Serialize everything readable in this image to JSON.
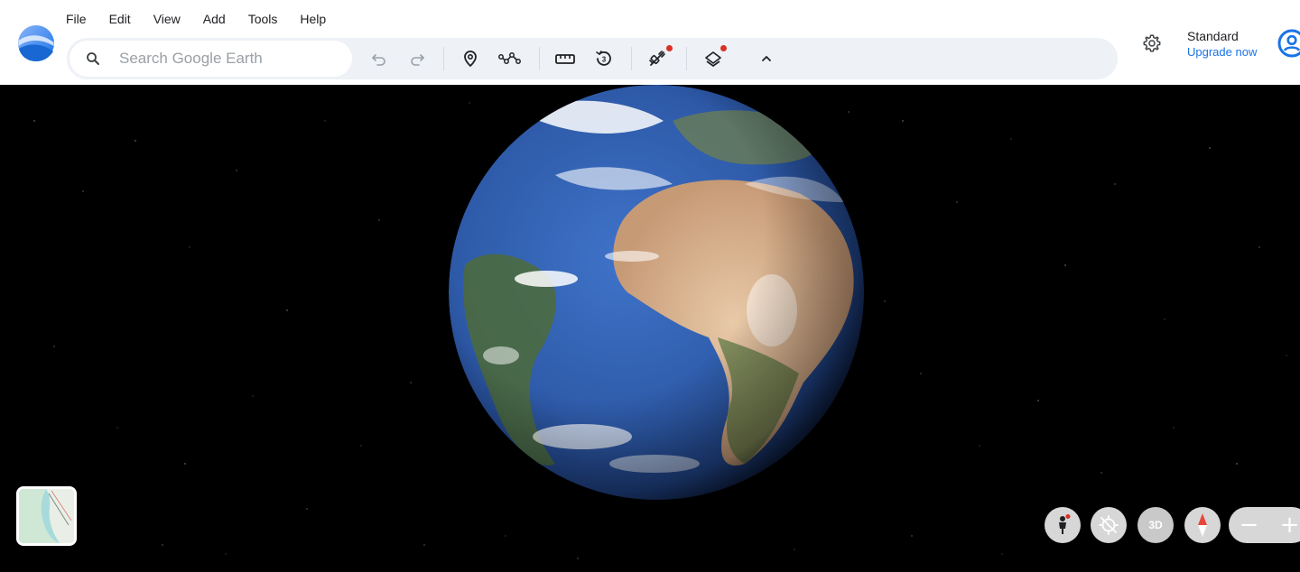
{
  "app": {
    "logo": "google-earth-logo"
  },
  "menu": {
    "items": [
      "File",
      "Edit",
      "View",
      "Add",
      "Tools",
      "Help"
    ]
  },
  "search": {
    "placeholder": "Search Google Earth",
    "value": ""
  },
  "toolbar": {
    "tools": [
      {
        "name": "undo-icon"
      },
      {
        "name": "redo-icon"
      },
      {
        "name": "add-placemark-icon"
      },
      {
        "name": "add-path-icon"
      },
      {
        "name": "measure-icon"
      },
      {
        "name": "historical-imagery-icon"
      },
      {
        "name": "projects-icon",
        "badge": true
      },
      {
        "name": "map-style-icon",
        "badge": true
      },
      {
        "name": "collapse-chevron-icon"
      }
    ]
  },
  "account": {
    "plan": "Standard",
    "upgrade": "Upgrade now"
  },
  "controls": {
    "three_d": "3D",
    "zoom_out": "−",
    "zoom_in": "+"
  },
  "colors": {
    "accent": "#1a73e8",
    "badge": "#d93025",
    "toolbar_bg": "#eef1f6"
  }
}
